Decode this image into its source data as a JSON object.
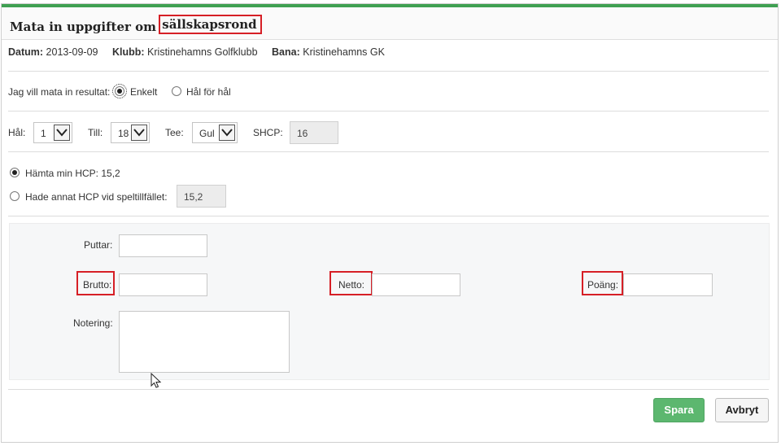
{
  "header": {
    "title_prefix": "Mata in uppgifter om",
    "title_highlight": "sällskapsrond"
  },
  "info": {
    "date_label": "Datum:",
    "date_value": "2013-09-09",
    "club_label": "Klubb:",
    "club_value": "Kristinehamns Golfklubb",
    "course_label": "Bana:",
    "course_value": "Kristinehamns GK"
  },
  "entry_mode": {
    "label": "Jag vill mata in resultat:",
    "options": [
      {
        "label": "Enkelt",
        "selected": true
      },
      {
        "label": "Hål för hål",
        "selected": false
      }
    ]
  },
  "holes": {
    "from_label": "Hål:",
    "from_value": "1",
    "to_label": "Till:",
    "to_value": "18",
    "tee_label": "Tee:",
    "tee_value": "Gul",
    "shcp_label": "SHCP:",
    "shcp_value": "16"
  },
  "hcp": {
    "fetch_label": "Hämta min HCP: 15,2",
    "fetch_selected": true,
    "other_label": "Hade annat HCP vid speltillfället:",
    "other_selected": false,
    "other_value": "15,2"
  },
  "score": {
    "putts_label": "Puttar:",
    "brutto_label": "Brutto:",
    "netto_label": "Netto:",
    "points_label": "Poäng:",
    "note_label": "Notering:"
  },
  "actions": {
    "save_label": "Spara",
    "cancel_label": "Avbryt"
  },
  "colors": {
    "accent_green": "#3fa052",
    "save_button": "#5cb76f",
    "highlight_red": "#d61f26"
  }
}
